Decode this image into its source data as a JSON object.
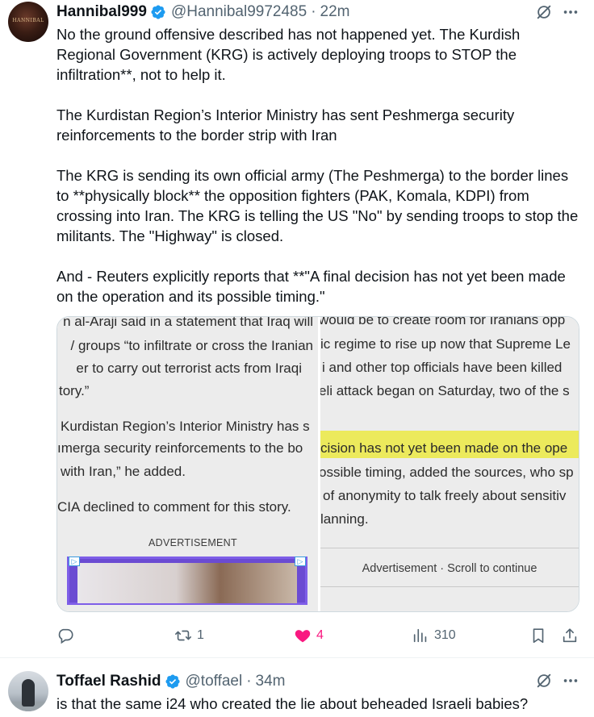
{
  "post1": {
    "author_name": "Hannibal999",
    "author_handle": "@Hannibal9972485",
    "separator": "·",
    "time": "22m",
    "avatar_text": "HANNIBAL",
    "paragraphs": [
      "No the ground offensive described has not happened yet.  The Kurdish Regional Government (KRG) is actively deploying troops to STOP the infiltration**, not to help it.",
      "The Kurdistan Region’s Interior Ministry has sent Peshmerga security reinforcements to the border strip with Iran",
      "The KRG is sending its own official army (The Peshmerga) to the border lines to **physically block** the opposition fighters (PAK, Komala, KDPI) from crossing into Iran. The KRG is telling the US \"No\" by sending troops to stop the militants. The \"Highway\" is closed.",
      "And - Reuters explicitly reports that **\"A final decision has not yet been made on the operation and its possible timing.\""
    ],
    "media": {
      "left_lines": [
        "n al-Araji said in a statement that Iraq will",
        "/ groups “to infiltrate or cross the Iranian",
        "er to carry out terrorist acts from Iraqi",
        "tory.”",
        "Kurdistan Region’s Interior Ministry has s",
        "ımerga security reinforcements to the bo",
        "with Iran,” he added.",
        "CIA declined to comment for this story."
      ],
      "left_ad_label": "ADVERTISEMENT",
      "ad_badge": "▷",
      "right_lines": [
        "would be to create room for Iranians opp",
        "ic regime to rise up now that Supreme Le",
        "i and other top officials have been killed",
        "eli attack began on Saturday, two of the s",
        "cision has not yet been made on the ope",
        "ossible timing, added the sources, who sp",
        "of anonymity to talk freely about sensitiv",
        "lanning."
      ],
      "right_ad_label": "Advertisement · Scroll to continue",
      "highlight_color": "#ecea5c"
    },
    "actions": {
      "replies": "",
      "reposts": "1",
      "likes": "4",
      "views": "310"
    }
  },
  "post2": {
    "author_name": "Toffael Rashid",
    "author_handle": "@toffael",
    "separator": "·",
    "time": "34m",
    "text": "is that the same i24 who created the lie about beheaded Israeli babies?"
  },
  "colors": {
    "verified_badge": "#1d9bf0",
    "like_active": "#f91880",
    "secondary_text": "#536471"
  }
}
